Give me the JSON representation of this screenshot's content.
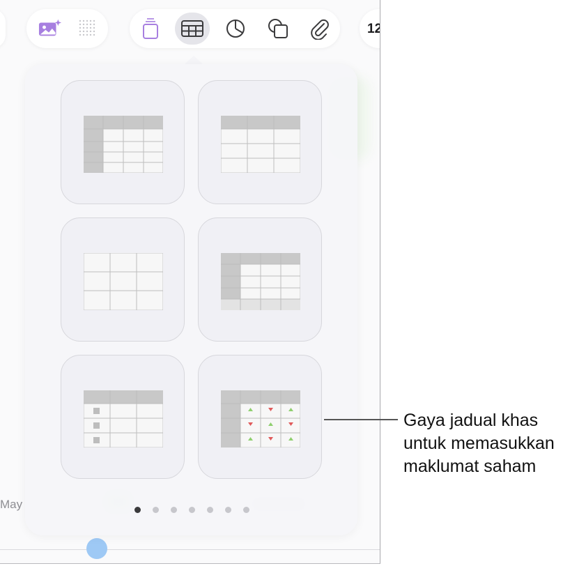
{
  "toolbar": {
    "left_items": [
      {
        "name": "media-icon",
        "selected": false
      },
      {
        "name": "grid-dots-icon",
        "selected": false
      }
    ],
    "main_items": [
      {
        "name": "text-box-icon",
        "selected": false
      },
      {
        "name": "table-icon",
        "selected": true
      },
      {
        "name": "chart-icon",
        "selected": false
      },
      {
        "name": "shape-icon",
        "selected": false
      },
      {
        "name": "attachment-icon",
        "selected": false
      }
    ],
    "right_label": "12",
    "accent_color": "#a77fe0"
  },
  "table_styles": [
    {
      "name": "header-row-and-column",
      "style": "hdr-row-col"
    },
    {
      "name": "header-row",
      "style": "hdr-row"
    },
    {
      "name": "plain",
      "style": "plain"
    },
    {
      "name": "header-row-column-footer",
      "style": "hdr-row-col-footer"
    },
    {
      "name": "checklist",
      "style": "checklist"
    },
    {
      "name": "stock",
      "style": "stock"
    }
  ],
  "pagination": {
    "total": 7,
    "current": 1
  },
  "background": {
    "month_label": "May"
  },
  "callout": {
    "lines": [
      "Gaya jadual khas",
      "untuk memasukkan",
      "maklumat saham"
    ]
  },
  "colors": {
    "up_arrow": "#8fcf6e",
    "down_arrow": "#e05a5a",
    "knob": "#9ec9f5"
  }
}
